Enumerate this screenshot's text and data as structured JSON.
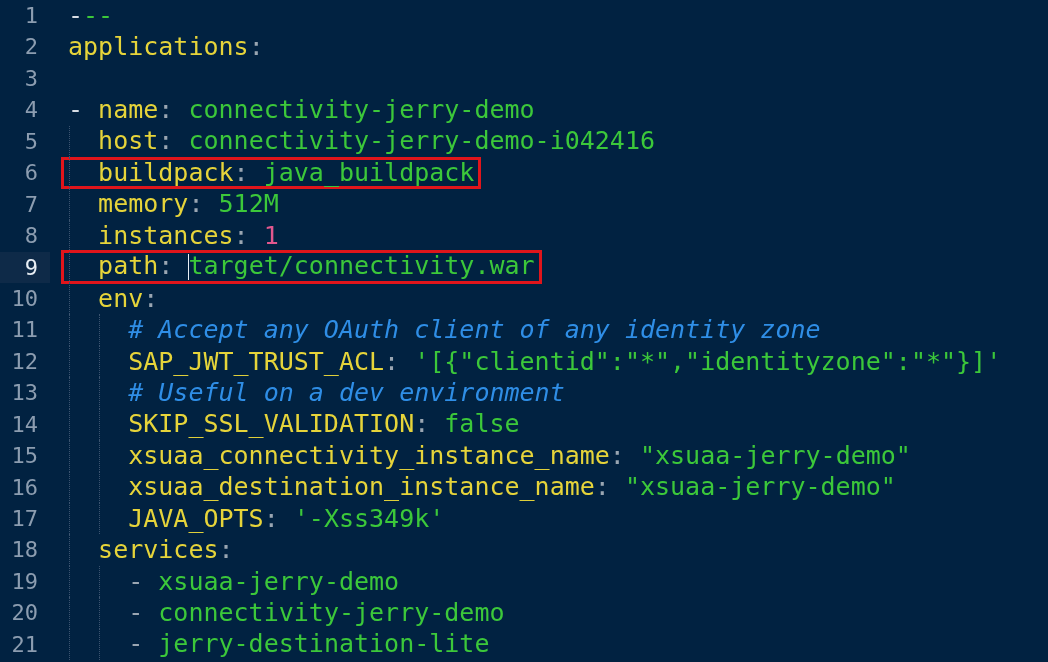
{
  "lines": [
    {
      "number": "1",
      "current": false,
      "highlighted": false,
      "tokens": [
        {
          "kind": "plain",
          "text": "-"
        },
        {
          "kind": "string",
          "text": "--"
        }
      ]
    },
    {
      "number": "2",
      "current": false,
      "highlighted": false,
      "tokens": [
        {
          "kind": "key",
          "text": "applications"
        },
        {
          "kind": "punct",
          "text": ":"
        }
      ]
    },
    {
      "number": "3",
      "current": false,
      "highlighted": false
    },
    {
      "number": "4",
      "current": false,
      "highlighted": false,
      "tokens": [
        {
          "kind": "plain",
          "text": "- "
        },
        {
          "kind": "key",
          "text": "name"
        },
        {
          "kind": "punct",
          "text": ": "
        },
        {
          "kind": "string",
          "text": "connectivity-jerry-demo"
        }
      ]
    },
    {
      "number": "5",
      "current": false,
      "highlighted": false,
      "tokens": [
        {
          "kind": "key",
          "text": "  host"
        },
        {
          "kind": "punct",
          "text": ": "
        },
        {
          "kind": "string",
          "text": "connectivity-jerry-demo-i042416"
        }
      ]
    },
    {
      "number": "6",
      "current": false,
      "highlighted": true,
      "tokens": [
        {
          "kind": "key",
          "text": "  buildpack"
        },
        {
          "kind": "punct",
          "text": ": "
        },
        {
          "kind": "string",
          "text": "java_buildpack"
        }
      ]
    },
    {
      "number": "7",
      "current": false,
      "highlighted": false,
      "tokens": [
        {
          "kind": "key",
          "text": "  memory"
        },
        {
          "kind": "punct",
          "text": ": "
        },
        {
          "kind": "string",
          "text": "512M"
        }
      ]
    },
    {
      "number": "8",
      "current": false,
      "highlighted": false,
      "tokens": [
        {
          "kind": "key",
          "text": "  instances"
        },
        {
          "kind": "punct",
          "text": ": "
        },
        {
          "kind": "number",
          "text": "1"
        }
      ]
    },
    {
      "number": "9",
      "current": true,
      "highlighted": true,
      "tokens": [
        {
          "kind": "key",
          "text": "  path"
        },
        {
          "kind": "punct",
          "text": ": "
        },
        {
          "kind": "string",
          "text": "target/connectivity.war",
          "caret": true
        }
      ]
    },
    {
      "number": "10",
      "current": false,
      "highlighted": false,
      "tokens": [
        {
          "kind": "key",
          "text": "  env"
        },
        {
          "kind": "punct",
          "text": ":"
        }
      ]
    },
    {
      "number": "11",
      "current": false,
      "highlighted": false,
      "tokens": [
        {
          "kind": "comment",
          "text": "    # Accept any OAuth client of any identity zone"
        }
      ]
    },
    {
      "number": "12",
      "current": false,
      "highlighted": false,
      "tokens": [
        {
          "kind": "key",
          "text": "    SAP_JWT_TRUST_ACL"
        },
        {
          "kind": "punct",
          "text": ": "
        },
        {
          "kind": "string",
          "text": "'[{\"clientid\":\"*\",\"identityzone\":\"*\"}]'"
        }
      ]
    },
    {
      "number": "13",
      "current": false,
      "highlighted": false,
      "tokens": [
        {
          "kind": "comment",
          "text": "    # Useful on a dev environment"
        }
      ]
    },
    {
      "number": "14",
      "current": false,
      "highlighted": false,
      "tokens": [
        {
          "kind": "key",
          "text": "    SKIP_SSL_VALIDATION"
        },
        {
          "kind": "punct",
          "text": ": "
        },
        {
          "kind": "string",
          "text": "false"
        }
      ]
    },
    {
      "number": "15",
      "current": false,
      "highlighted": false,
      "tokens": [
        {
          "kind": "key",
          "text": "    xsuaa_connectivity_instance_name"
        },
        {
          "kind": "punct",
          "text": ": "
        },
        {
          "kind": "string",
          "text": "\"xsuaa-jerry-demo\""
        }
      ]
    },
    {
      "number": "16",
      "current": false,
      "highlighted": false,
      "tokens": [
        {
          "kind": "key",
          "text": "    xsuaa_destination_instance_name"
        },
        {
          "kind": "punct",
          "text": ": "
        },
        {
          "kind": "string",
          "text": "\"xsuaa-jerry-demo\""
        }
      ]
    },
    {
      "number": "17",
      "current": false,
      "highlighted": false,
      "tokens": [
        {
          "kind": "key",
          "text": "    JAVA_OPTS"
        },
        {
          "kind": "punct",
          "text": ": "
        },
        {
          "kind": "string",
          "text": "'-Xss349k'"
        }
      ]
    },
    {
      "number": "18",
      "current": false,
      "highlighted": false,
      "tokens": [
        {
          "kind": "key",
          "text": "  services"
        },
        {
          "kind": "punct",
          "text": ":"
        }
      ]
    },
    {
      "number": "19",
      "current": false,
      "highlighted": false,
      "tokens": [
        {
          "kind": "punct",
          "text": "    - "
        },
        {
          "kind": "string",
          "text": "xsuaa-jerry-demo"
        }
      ]
    },
    {
      "number": "20",
      "current": false,
      "highlighted": false,
      "tokens": [
        {
          "kind": "punct",
          "text": "    - "
        },
        {
          "kind": "string",
          "text": "connectivity-jerry-demo"
        }
      ]
    },
    {
      "number": "21",
      "current": false,
      "highlighted": false,
      "tokens": [
        {
          "kind": "punct",
          "text": "    - "
        },
        {
          "kind": "string",
          "text": "jerry-destination-lite"
        }
      ]
    }
  ]
}
